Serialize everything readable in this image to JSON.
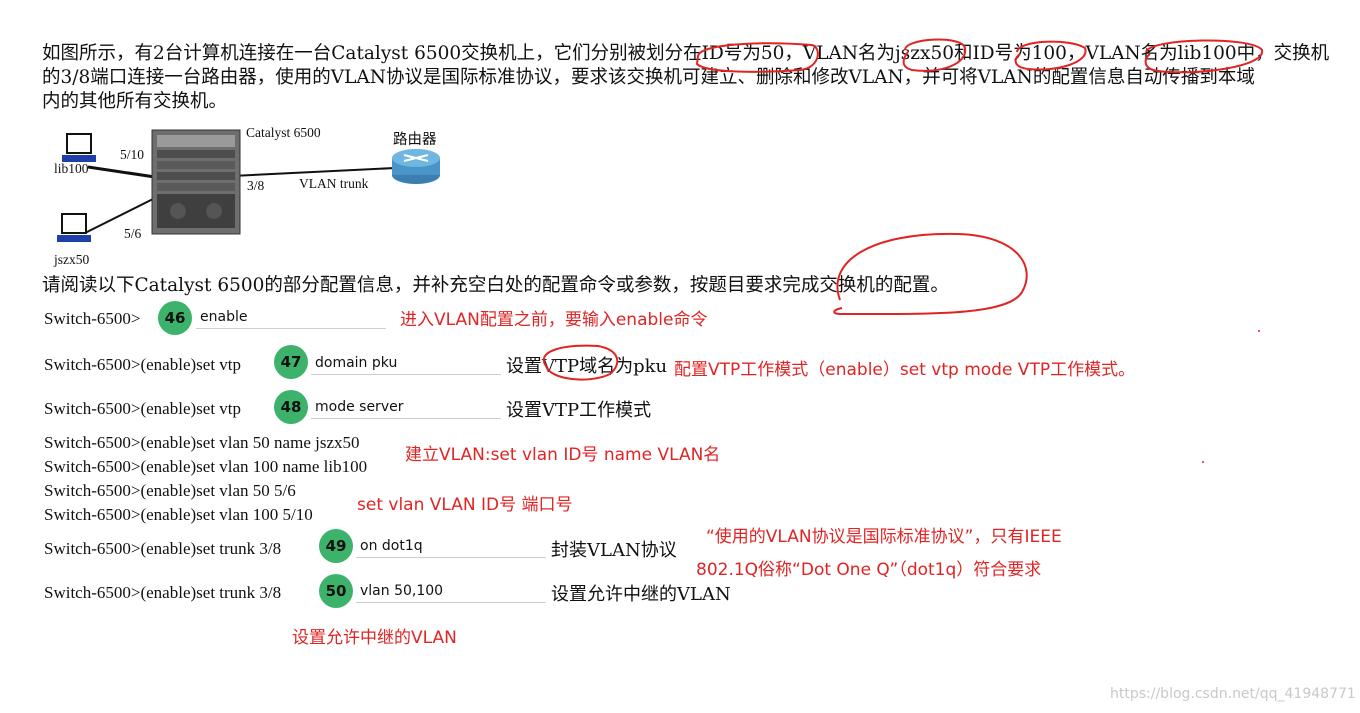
{
  "intro": {
    "line1": "如图所示，有2台计算机连接在一台Catalyst 6500交换机上，它们分别被划分在ID号为50，VLAN名为jszx50和ID号为100，VLAN名为lib100中，交换机",
    "line2": "的3/8端口连接一台路由器，使用的VLAN协议是国际标准协议，要求该交换机可建立、删除和修改VLAN，并可将VLAN的配置信息自动传播到本域",
    "line3": "内的其他所有交换机。"
  },
  "diagram": {
    "switch_label": "Catalyst 6500",
    "router_label": "路由器",
    "port_lib100": "5/10",
    "pc_lib100": "lib100",
    "port_jszx50": "5/6",
    "pc_jszx50": "jszx50",
    "port_router": "3/8",
    "link_label": "VLAN trunk"
  },
  "instruction": "请阅读以下Catalyst 6500的部分配置信息，并补充空白处的配置命令或参数，按题目要求完成交换机的配置。",
  "commands": [
    {
      "prompt": "Switch-6500>",
      "badge": "46",
      "answer": "enable",
      "note": "",
      "red_note": "进入VLAN配置之前，要输入enable命令"
    },
    {
      "prompt": "Switch-6500>(enable)set vtp",
      "badge": "47",
      "answer": "domain pku",
      "note": "设置VTP域名为pku",
      "red_note": "配置VTP工作模式（enable）set vtp mode  VTP工作模式。"
    },
    {
      "prompt": "Switch-6500>(enable)set vtp",
      "badge": "48",
      "answer": "mode server",
      "note": "设置VTP工作模式",
      "red_note": ""
    },
    {
      "prompt": "Switch-6500>(enable)set trunk 3/8",
      "badge": "49",
      "answer": "on dot1q",
      "note": "封装VLAN协议",
      "red_note": ""
    },
    {
      "prompt": "Switch-6500>(enable)set trunk 3/8",
      "badge": "50",
      "answer": "vlan 50,100",
      "note": "设置允许中继的VLAN",
      "red_note": ""
    }
  ],
  "static_lines": [
    "Switch-6500>(enable)set vlan 50 name jszx50",
    "Switch-6500>(enable)set vlan 100 name lib100",
    "Switch-6500>(enable)set vlan 50 5/6",
    "Switch-6500>(enable)set vlan 100 5/10"
  ],
  "red_notes": {
    "create_vlan": "建立VLAN:set vlan ID号 name VLAN名",
    "set_port": "set vlan  VLAN ID号 端口号",
    "ieee_1": "“使用的VLAN协议是国际标准协议”，只有IEEE",
    "ieee_2": "802.1Q俗称“Dot One Q”（dot1q）符合要求",
    "allow_trunk": "设置允许中继的VLAN"
  },
  "watermark": "https://blog.csdn.net/qq_41948771",
  "colors": {
    "badge": "#3cb26a",
    "annotation": "#e02424"
  }
}
